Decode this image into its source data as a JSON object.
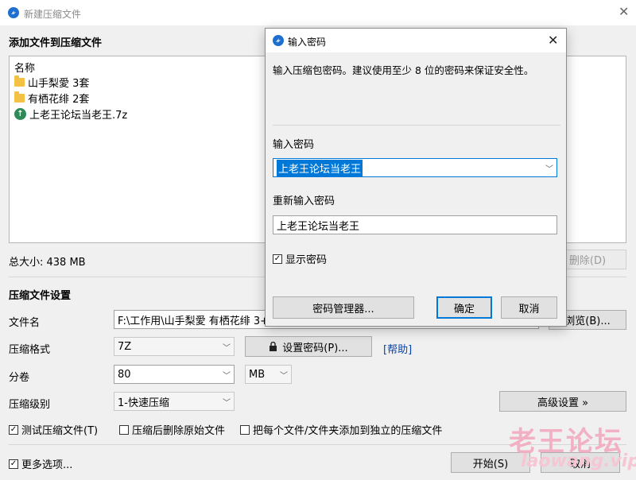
{
  "window": {
    "title": "新建压缩文件"
  },
  "add_section": {
    "heading": "添加文件到压缩文件"
  },
  "file_list": {
    "column_name": "名称",
    "items": [
      {
        "icon": "folder-icon",
        "name": "山手梨愛 3套"
      },
      {
        "icon": "folder-icon",
        "name": "有栖花绯 2套"
      },
      {
        "icon": "archive-icon",
        "name": "上老王论坛当老王.7z"
      }
    ]
  },
  "total_size": "总大小: 438 MB",
  "delete_button": "删除(D)",
  "settings": {
    "heading": "压缩文件设置",
    "filename_label": "文件名",
    "filename_value": "F:\\工作用\\山手梨愛 有栖花绯 3+",
    "browse_button": "浏览(B)...",
    "format_label": "压缩格式",
    "format_value": "7Z",
    "set_password_button": "设置密码(P)...",
    "help_link": "[帮助]",
    "volume_label": "分卷",
    "volume_value": "80",
    "volume_unit": "MB",
    "level_label": "压缩级别",
    "level_value": "1-快速压缩",
    "advanced_button": "高级设置 »",
    "test_archive": "测试压缩文件(T)",
    "delete_after": "压缩后删除原始文件",
    "separate_archives": "把每个文件/文件夹添加到独立的压缩文件",
    "more_options": "更多选项...",
    "start_button": "开始(S)",
    "cancel_button": "取消"
  },
  "password_dialog": {
    "title": "输入密码",
    "description": "输入压缩包密码。建议使用至少 8 位的密码来保证安全性。",
    "enter_label": "输入密码",
    "enter_value": "上老王论坛当老王",
    "reenter_label": "重新输入密码",
    "reenter_value": "上老王论坛当老王",
    "show_password": "显示密码",
    "manager_button": "密码管理器...",
    "ok_button": "确定",
    "cancel_button": "取消"
  },
  "watermark": {
    "main": "老王论坛",
    "sub": "laowang.vip"
  },
  "colors": {
    "accent": "#0078d7",
    "link": "#0645ad",
    "watermark": "#f2b0c4"
  }
}
